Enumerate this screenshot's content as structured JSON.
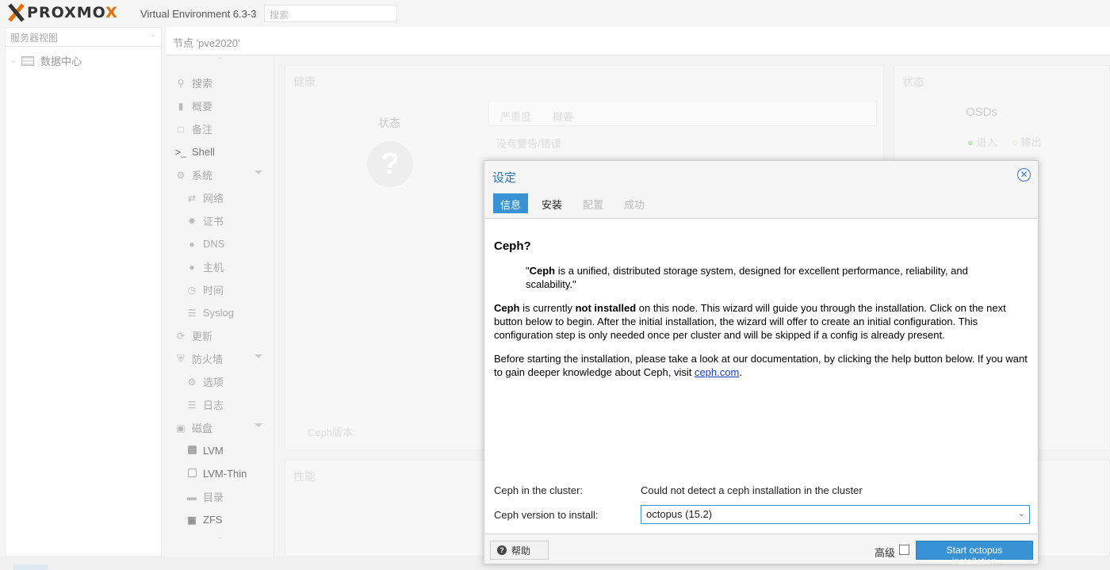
{
  "header": {
    "logo_text": "PROXMOX",
    "version": "Virtual Environment 6.3-3",
    "search_placeholder": "搜索"
  },
  "tree": {
    "view": "服务器视图",
    "items": [
      {
        "label": "数据中心",
        "icon": "datacenter-icon"
      }
    ]
  },
  "node": {
    "title": "节点 'pve2020'"
  },
  "nav": {
    "items": [
      {
        "label": "搜索",
        "icon": "search-icon",
        "level": 1
      },
      {
        "label": "概要",
        "icon": "book-icon",
        "level": 1
      },
      {
        "label": "备注",
        "icon": "note-icon",
        "level": 1
      },
      {
        "label": "Shell",
        "icon": "terminal-icon",
        "level": 1
      },
      {
        "label": "系统",
        "icon": "gears-icon",
        "level": 1
      },
      {
        "label": "网络",
        "icon": "exchange-icon",
        "level": 2
      },
      {
        "label": "证书",
        "icon": "certificate-icon",
        "level": 2
      },
      {
        "label": "DNS",
        "icon": "globe-icon",
        "level": 2
      },
      {
        "label": "主机",
        "icon": "globe-icon",
        "level": 2
      },
      {
        "label": "时间",
        "icon": "clock-icon",
        "level": 2
      },
      {
        "label": "Syslog",
        "icon": "list-icon",
        "level": 2
      },
      {
        "label": "更新",
        "icon": "refresh-icon",
        "level": 1
      },
      {
        "label": "防火墙",
        "icon": "shield-icon",
        "level": 1
      },
      {
        "label": "选项",
        "icon": "gear-icon",
        "level": 2
      },
      {
        "label": "日志",
        "icon": "list-icon",
        "level": 2
      },
      {
        "label": "磁盘",
        "icon": "hdd-icon",
        "level": 1
      },
      {
        "label": "LVM",
        "icon": "square-icon",
        "level": 2
      },
      {
        "label": "LVM-Thin",
        "icon": "square-outline-icon",
        "level": 2
      },
      {
        "label": "目录",
        "icon": "folder-icon",
        "level": 2
      },
      {
        "label": "ZFS",
        "icon": "grid-icon",
        "level": 2
      }
    ]
  },
  "background": {
    "health_title": "健康",
    "status_label": "状态",
    "severity_col": "严重度",
    "summary_col": "概要",
    "no_warnings": "没有警告/错误",
    "status_title": "状态",
    "osds_label": "OSDs",
    "in_label": "进入",
    "out_label": "输出",
    "ceph_version": "Ceph版本:",
    "perf_title": "性能"
  },
  "modal": {
    "title": "设定",
    "tabs": [
      {
        "label": "信息",
        "state": "active"
      },
      {
        "label": "安装",
        "state": "normal"
      },
      {
        "label": "配置",
        "state": "disabled"
      },
      {
        "label": "成功",
        "state": "disabled"
      }
    ],
    "heading": "Ceph?",
    "quote_open": "\"",
    "quote_bold": "Ceph",
    "quote_rest": " is a unified, distributed storage system, designed for excellent performance, reliability, and scalability.\"",
    "p1_b1": "Ceph",
    "p1_t1": " is currently ",
    "p1_b2": "not installed",
    "p1_t2": " on this node. This wizard will guide you through the installation. Click on the next button below to begin. After the initial installation, the wizard will offer to create an initial configuration. This configuration step is only needed once per cluster and will be skipped if a config is already present.",
    "p2_text": "Before starting the installation, please take a look at our documentation, by clicking the help button below. If you want to gain deeper knowledge about Ceph, visit ",
    "p2_link": "ceph.com",
    "p2_end": ".",
    "cluster_label": "Ceph in the cluster:",
    "cluster_value": "Could not detect a ceph installation in the cluster",
    "version_label": "Ceph version to install:",
    "version_value": "octopus (15.2)",
    "help_label": "帮助",
    "advanced_label": "高级",
    "advanced_checked": false,
    "start_label": "Start octopus installation"
  },
  "colors": {
    "accent": "#3892d4",
    "title_blue": "#2e73b8",
    "logo_orange": "#e57000"
  }
}
